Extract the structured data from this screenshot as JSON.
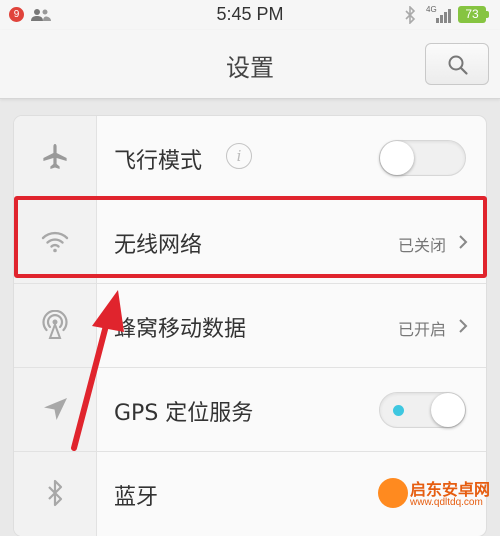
{
  "status_bar": {
    "notification_count": "9",
    "time": "5:45 PM",
    "network_type": "4G",
    "battery_level": "73"
  },
  "header": {
    "title": "设置",
    "search_icon": "search-icon"
  },
  "settings": [
    {
      "label": "飞行模式",
      "icon": "airplane-icon",
      "control": "toggle",
      "on": false
    },
    {
      "label": "无线网络",
      "icon": "wifi-icon",
      "value": "已关闭",
      "control": "chevron"
    },
    {
      "label": "蜂窝移动数据",
      "icon": "cellular-icon",
      "value": "已开启",
      "control": "chevron"
    },
    {
      "label": "GPS 定位服务",
      "icon": "location-icon",
      "control": "toggle",
      "on": true
    },
    {
      "label": "蓝牙",
      "icon": "bluetooth-icon"
    }
  ],
  "annotation": {
    "highlight_color": "#e0242d",
    "highlighted_item": "无线网络"
  },
  "watermark": {
    "name": "启东安卓网",
    "url": "www.qdltdq.com"
  },
  "colors": {
    "accent": "#3ec7e0",
    "battery": "#86c441",
    "annotation": "#e0242d"
  }
}
